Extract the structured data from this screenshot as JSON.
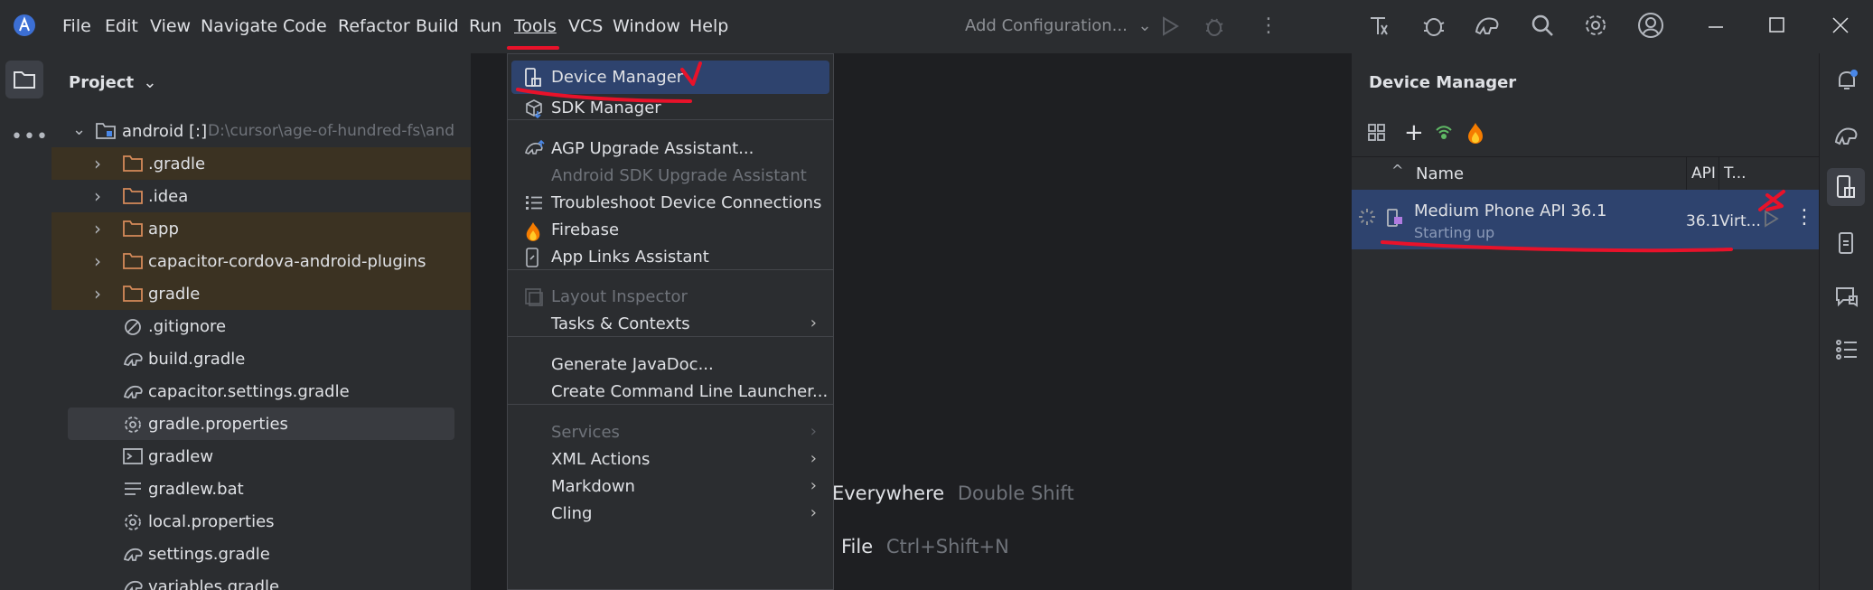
{
  "menubar": {
    "items": [
      "File",
      "Edit",
      "View",
      "Navigate",
      "Code",
      "Refactor",
      "Build",
      "Run",
      "Tools",
      "VCS",
      "Window",
      "Help"
    ],
    "run_config": "Add Configuration..."
  },
  "project": {
    "title": "Project",
    "root_name": "android [:]",
    "root_path": "D:\\cursor\\age-of-hundred-fs\\and",
    "items": [
      {
        "label": ".gradle",
        "icon": "folder-icon"
      },
      {
        "label": ".idea",
        "icon": "folder-icon"
      },
      {
        "label": "app",
        "icon": "folder-icon"
      },
      {
        "label": "capacitor-cordova-android-plugins",
        "icon": "folder-icon"
      },
      {
        "label": "gradle",
        "icon": "folder-icon"
      },
      {
        "label": ".gitignore",
        "icon": "ignore-file-icon"
      },
      {
        "label": "build.gradle",
        "icon": "gradle-elephant-icon"
      },
      {
        "label": "capacitor.settings.gradle",
        "icon": "gradle-elephant-icon"
      },
      {
        "label": "gradle.properties",
        "icon": "gear-icon"
      },
      {
        "label": "gradlew",
        "icon": "terminal-icon"
      },
      {
        "label": "gradlew.bat",
        "icon": "text-lines-icon"
      },
      {
        "label": "local.properties",
        "icon": "gear-icon"
      },
      {
        "label": "settings.gradle",
        "icon": "gradle-elephant-icon"
      },
      {
        "label": "variables.gradle",
        "icon": "gradle-elephant-icon"
      }
    ]
  },
  "tools_menu": {
    "items": [
      {
        "label": "Device Manager",
        "icon": "device-manager-icon"
      },
      {
        "label": "SDK Manager",
        "icon": "sdk-box-icon"
      },
      {
        "label": "AGP Upgrade Assistant...",
        "icon": "upgrade-icon"
      },
      {
        "label": "Android SDK Upgrade Assistant",
        "icon": ""
      },
      {
        "label": "Troubleshoot Device Connections",
        "icon": "list-icon"
      },
      {
        "label": "Firebase",
        "icon": "firebase-icon"
      },
      {
        "label": "App Links Assistant",
        "icon": "app-links-icon"
      },
      {
        "label": "Layout Inspector",
        "icon": "layout-inspector-icon"
      },
      {
        "label": "Tasks & Contexts",
        "icon": ""
      },
      {
        "label": "Generate JavaDoc...",
        "icon": ""
      },
      {
        "label": "Create Command Line Launcher...",
        "icon": ""
      },
      {
        "label": "Services",
        "icon": ""
      },
      {
        "label": "XML Actions",
        "icon": ""
      },
      {
        "label": "Markdown",
        "icon": ""
      },
      {
        "label": "Cling",
        "icon": ""
      }
    ]
  },
  "editor_hints": {
    "search_label": "n Everywhere",
    "search_shortcut": "Double Shift",
    "file_label": "File",
    "file_shortcut": "Ctrl+Shift+N"
  },
  "device_manager": {
    "title": "Device Manager",
    "col_name": "Name",
    "col_api": "API",
    "col_type": "T...",
    "device": {
      "name": "Medium Phone API 36.1",
      "status": "Starting up",
      "api": "36.1",
      "type": "Virt..."
    }
  },
  "colors": {
    "accent_blue": "#2e436e",
    "highlight_orange": "#3b3222",
    "annotation_red": "#e8122a"
  }
}
